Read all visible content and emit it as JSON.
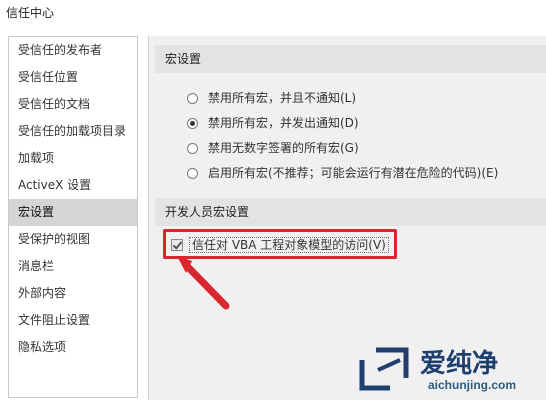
{
  "window": {
    "title": "信任中心"
  },
  "sidebar": {
    "items": [
      {
        "label": "受信任的发布者",
        "selected": false
      },
      {
        "label": "受信任位置",
        "selected": false
      },
      {
        "label": "受信任的文档",
        "selected": false
      },
      {
        "label": "受信任的加载项目录",
        "selected": false
      },
      {
        "label": "加载项",
        "selected": false
      },
      {
        "label": "ActiveX 设置",
        "selected": false
      },
      {
        "label": "宏设置",
        "selected": true
      },
      {
        "label": "受保护的视图",
        "selected": false
      },
      {
        "label": "消息栏",
        "selected": false
      },
      {
        "label": "外部内容",
        "selected": false
      },
      {
        "label": "文件阻止设置",
        "selected": false
      },
      {
        "label": "隐私选项",
        "selected": false
      }
    ]
  },
  "macro_settings": {
    "header": "宏设置",
    "options": [
      {
        "label": "禁用所有宏，并且不通知(L)",
        "checked": false
      },
      {
        "label": "禁用所有宏，并发出通知(D)",
        "checked": true
      },
      {
        "label": "禁用无数字签署的所有宏(G)",
        "checked": false
      },
      {
        "label": "启用所有宏(不推荐；可能会运行有潜在危险的代码)(E)",
        "checked": false
      }
    ]
  },
  "developer_settings": {
    "header": "开发人员宏设置",
    "trust_vba": {
      "label": "信任对 VBA 工程对象模型的访问(V)",
      "checked": true
    }
  },
  "colors": {
    "highlight": "#d9262f",
    "selected_bg": "#d5d5d5",
    "panel_bg": "#f0f0f0"
  },
  "watermark": {
    "text": "爱纯净",
    "url_text": "aichunjing.com"
  }
}
